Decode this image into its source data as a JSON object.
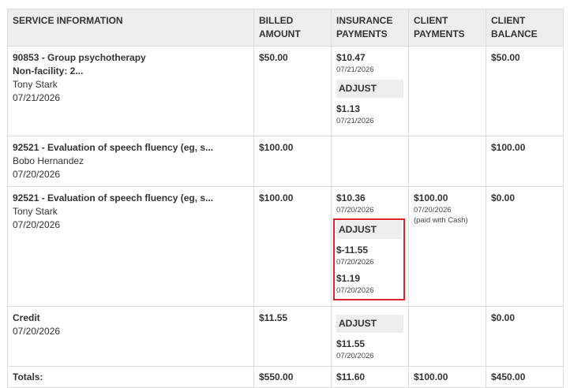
{
  "headers": {
    "service": "SERVICE INFORMATION",
    "billed": "BILLED AMOUNT",
    "insurance": "INSURANCE PAYMENTS",
    "client": "CLIENT PAYMENTS",
    "balance": "CLIENT BALANCE"
  },
  "rows": [
    {
      "title": "90853 - Group psychotherapy",
      "subtitle": "Non-facility: 2...",
      "client_name": "Tony Stark",
      "date": "07/21/2026",
      "billed": "$50.00",
      "ins_amount": "$10.47",
      "ins_date": "07/21/2026",
      "adjust_label": "ADJUST",
      "adj_amount": "$1.13",
      "adj_date": "07/21/2026",
      "balance": "$50.00"
    },
    {
      "title": "92521 - Evaluation of speech fluency (eg, s...",
      "client_name": "Bobo Hernandez",
      "date": "07/20/2026",
      "billed": "$100.00",
      "balance": "$100.00"
    },
    {
      "title": "92521 - Evaluation of speech fluency (eg, s...",
      "client_name": "Tony Stark",
      "date": "07/20/2026",
      "billed": "$100.00",
      "ins_amount": "$10.36",
      "ins_date": "07/20/2026",
      "adjust_label": "ADJUST",
      "adj1_amount": "$-11.55",
      "adj1_date": "07/20/2026",
      "adj2_amount": "$1.19",
      "adj2_date": "07/20/2026",
      "client_amount": "$100.00",
      "client_date": "07/20/2026",
      "client_note": "(paid with Cash)",
      "balance": "$0.00"
    },
    {
      "title": "Credit",
      "date": "07/20/2026",
      "billed": "$11.55",
      "adjust_label": "ADJUST",
      "adj_amount": "$11.55",
      "adj_date": "07/20/2026",
      "balance": "$0.00"
    }
  ],
  "totals": {
    "label": "Totals:",
    "billed": "$550.00",
    "insurance": "$11.60",
    "client": "$100.00",
    "balance": "$450.00"
  },
  "colors": {
    "header_bg": "#eeeeee",
    "highlight_border": "#d9262c"
  }
}
